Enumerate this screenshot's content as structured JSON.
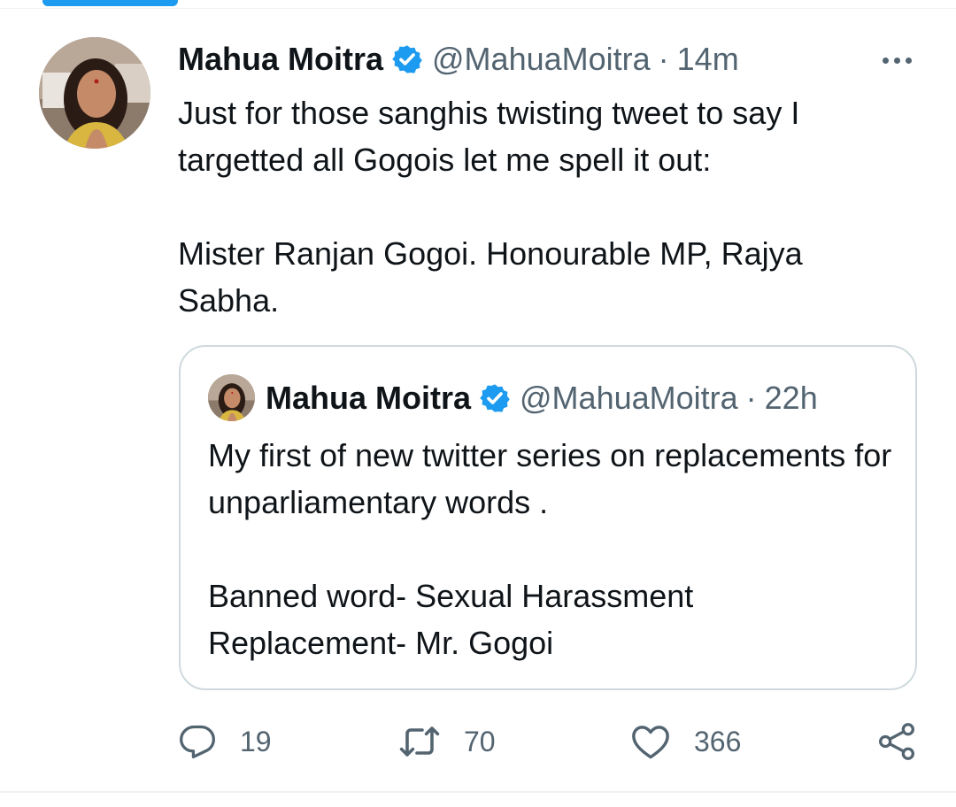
{
  "tweet": {
    "author": {
      "name": "Mahua Moitra",
      "handle": "@MahuaMoitra",
      "verified": true
    },
    "separator": "·",
    "time": "14m",
    "text": "Just for those sanghis twisting tweet to say I targetted all Gogois let me spell it out:\n\nMister Ranjan Gogoi. Honourable MP, Rajya Sabha.",
    "quoted": {
      "author": {
        "name": "Mahua Moitra",
        "handle": "@MahuaMoitra",
        "verified": true
      },
      "separator": "·",
      "time": "22h",
      "text": "My first of new twitter series on replacements for unparliamentary words .\n\nBanned word- Sexual Harassment\nReplacement- Mr. Gogoi"
    },
    "actions": {
      "replies": "19",
      "retweets": "70",
      "likes": "366"
    }
  },
  "icons": {
    "verified": "verified-badge-icon",
    "more": "more-dots-icon",
    "reply": "reply-bubble-icon",
    "retweet": "retweet-arrows-icon",
    "like": "heart-icon",
    "share": "share-icon"
  },
  "colors": {
    "accent": "#1d9bf0",
    "text_primary": "#0f1419",
    "text_secondary": "#536471",
    "border": "#cfd9de"
  }
}
